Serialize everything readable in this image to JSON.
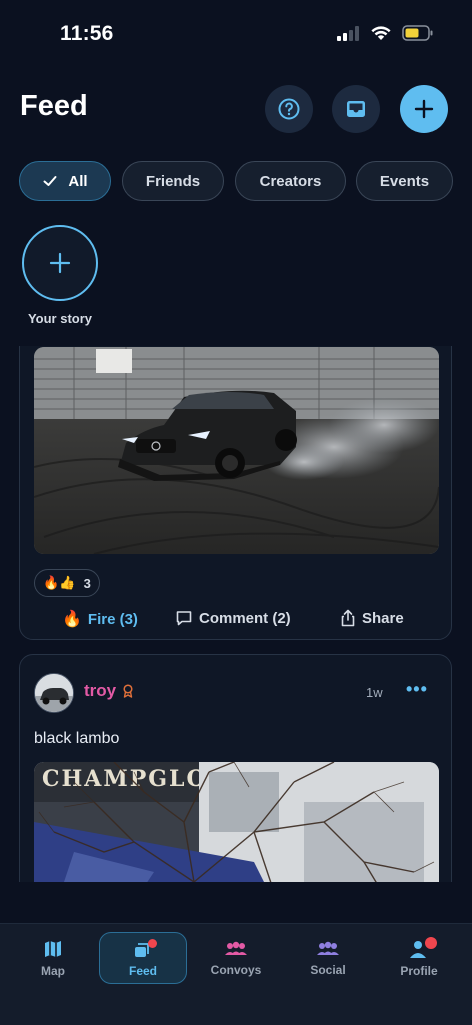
{
  "status": {
    "time": "11:56"
  },
  "header": {
    "title": "Feed"
  },
  "filters": [
    "All",
    "Friends",
    "Creators",
    "Events"
  ],
  "story": {
    "label": "Your story"
  },
  "posts": [
    {
      "reaction_count": "3",
      "actions": {
        "fire": "Fire (3)",
        "comment": "Comment (2)",
        "share": "Share"
      }
    },
    {
      "username": "troy",
      "time": "1w",
      "caption": "black lambo"
    }
  ],
  "tabs": [
    "Map",
    "Feed",
    "Convoys",
    "Social",
    "Profile"
  ],
  "colors": {
    "accent": "#5fbdf0",
    "username": "#e35aa5",
    "background": "#0b1120"
  }
}
